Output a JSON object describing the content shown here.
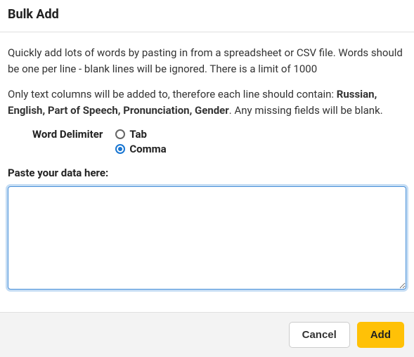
{
  "header": {
    "title": "Bulk Add"
  },
  "content": {
    "description": "Quickly add lots of words by pasting in from a spreadsheet or CSV file. Words should be one per line - blank lines will be ignored. There is a limit of 1000",
    "columns_prefix": "Only text columns will be added to, therefore each line should contain: ",
    "columns_bold": "Russian, English, Part of Speech, Pronunciation, Gender",
    "columns_suffix": ". Any missing fields will be blank.",
    "delimiter_label": "Word Delimiter",
    "delimiter_options": {
      "tab": "Tab",
      "comma": "Comma"
    },
    "delimiter_selected": "comma",
    "paste_label": "Paste your data here:",
    "textarea_value": ""
  },
  "footer": {
    "cancel_label": "Cancel",
    "add_label": "Add"
  }
}
